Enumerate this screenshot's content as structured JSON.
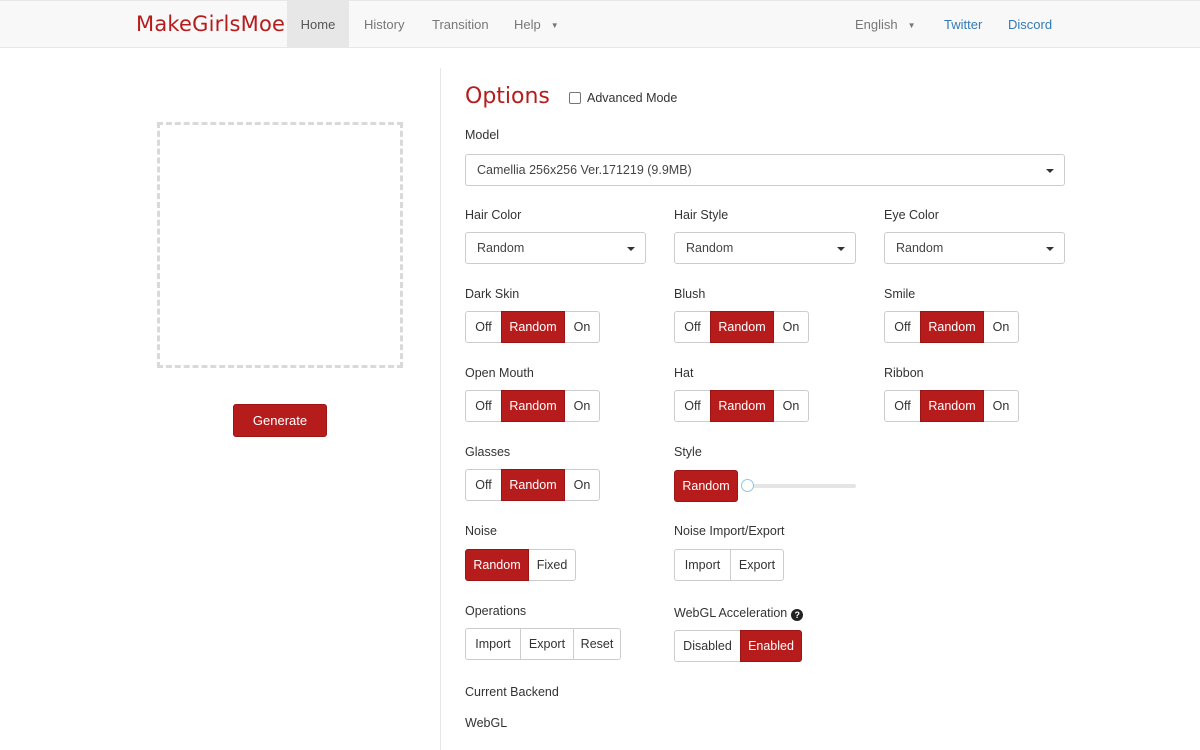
{
  "nav": {
    "brand": "MakeGirlsMoe",
    "items": [
      {
        "label": "Home",
        "active": true
      },
      {
        "label": "History",
        "active": false
      },
      {
        "label": "Transition",
        "active": false
      },
      {
        "label": "Help",
        "active": false
      }
    ],
    "language": "English",
    "twitter": "Twitter",
    "discord": "Discord"
  },
  "left": {
    "generate_label": "Generate"
  },
  "options": {
    "title": "Options",
    "advanced_mode": "Advanced Mode",
    "advanced_checked": false,
    "model_label": "Model",
    "model_value": "Camellia 256x256 Ver.171219 (9.9MB)",
    "hair_color_label": "Hair Color",
    "hair_color_value": "Random",
    "hair_style_label": "Hair Style",
    "hair_style_value": "Random",
    "eye_color_label": "Eye Color",
    "eye_color_value": "Random",
    "toggles": {
      "off": "Off",
      "random": "Random",
      "on": "On"
    },
    "dark_skin_label": "Dark Skin",
    "blush_label": "Blush",
    "smile_label": "Smile",
    "open_mouth_label": "Open Mouth",
    "hat_label": "Hat",
    "ribbon_label": "Ribbon",
    "glasses_label": "Glasses",
    "style_label": "Style",
    "style_button": "Random",
    "style_slider_value": 0,
    "noise_label": "Noise",
    "noise_random": "Random",
    "noise_fixed": "Fixed",
    "noise_io_label": "Noise Import/Export",
    "import": "Import",
    "export": "Export",
    "reset": "Reset",
    "operations_label": "Operations",
    "webgl_label": "WebGL Acceleration",
    "disabled": "Disabled",
    "enabled": "Enabled",
    "backend_label": "Current Backend",
    "backend_value": "WebGL"
  },
  "colors": {
    "accent": "#b71c1c",
    "link": "#337ab7"
  }
}
